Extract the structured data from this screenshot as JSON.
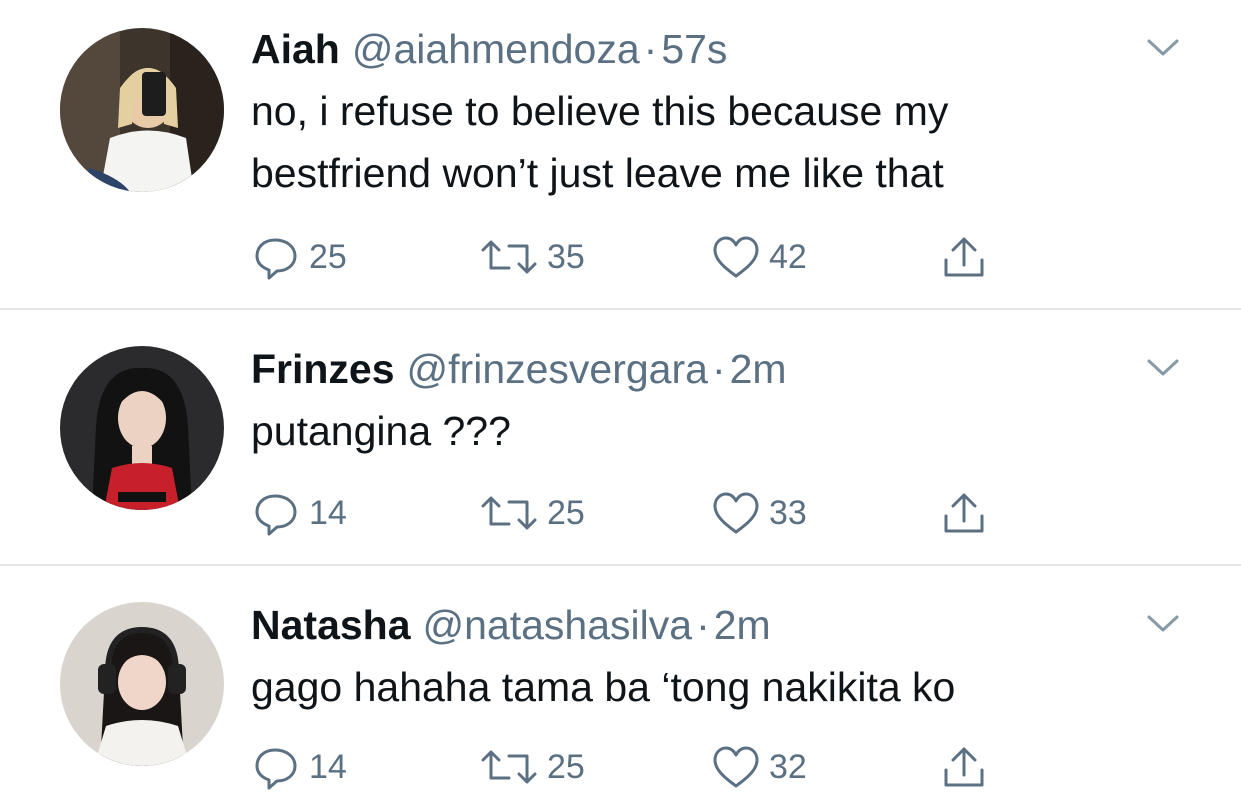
{
  "tweets": [
    {
      "name": "Aiah",
      "handle": "@aiahmendoza",
      "time": "57s",
      "separator": "·",
      "lines": [
        "no, i refuse to believe this because my",
        "bestfriend won’t just leave me like that"
      ],
      "replies": "25",
      "retweets": "35",
      "likes": "42"
    },
    {
      "name": "Frinzes",
      "handle": "@frinzesvergara",
      "time": "2m",
      "separator": "·",
      "lines": [
        "putangina ???"
      ],
      "replies": "14",
      "retweets": "25",
      "likes": "33"
    },
    {
      "name": "Natasha",
      "handle": "@natashasilva",
      "time": "2m",
      "separator": "·",
      "lines": [
        "gago hahaha tama ba ‘tong nakikita ko"
      ],
      "replies": "14",
      "retweets": "25",
      "likes": "32"
    }
  ],
  "icons": {
    "reply": "reply-icon",
    "retweet": "retweet-icon",
    "like": "heart-icon",
    "share": "share-icon",
    "menu": "chevron-down-icon"
  },
  "colors": {
    "text": "#0f1419",
    "secondary": "#5b7083",
    "divider": "#e1e5e8",
    "background": "#ffffff"
  }
}
